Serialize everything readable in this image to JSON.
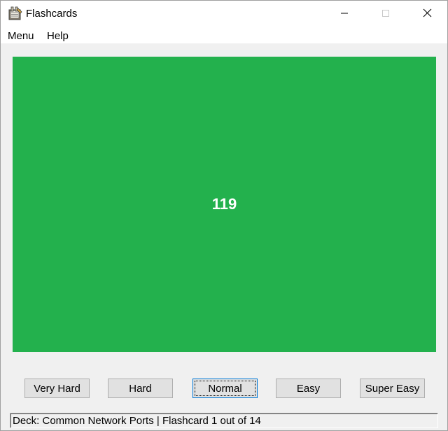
{
  "window": {
    "title": "Flashcards",
    "app_icon": "notebook-icon",
    "controls": [
      "minimize-icon",
      "maximize-icon",
      "close-icon"
    ]
  },
  "menubar": {
    "items": [
      {
        "label": "Menu"
      },
      {
        "label": "Help"
      }
    ]
  },
  "card": {
    "text": "119",
    "background_color": "#23b14d",
    "text_color": "#ffffff"
  },
  "rating_buttons": [
    {
      "label": "Very Hard"
    },
    {
      "label": "Hard"
    },
    {
      "label": "Normal",
      "focused": true
    },
    {
      "label": "Easy"
    },
    {
      "label": "Super Easy"
    }
  ],
  "status": {
    "text": "Deck: Common Network Ports | Flashcard 1 out of 14"
  }
}
